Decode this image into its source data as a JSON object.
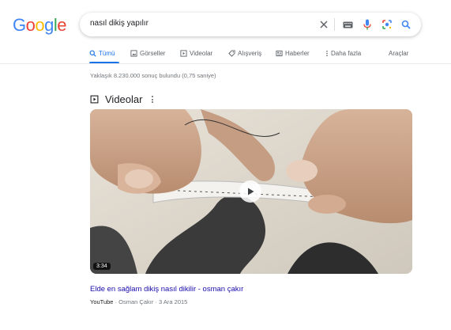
{
  "logo": {
    "letters": [
      "G",
      "o",
      "o",
      "g",
      "l",
      "e"
    ],
    "colors": [
      "#4285F4",
      "#EA4335",
      "#FBBC05",
      "#4285F4",
      "#34A853",
      "#EA4335"
    ]
  },
  "search": {
    "query": "nasıl dikiş yapılır",
    "icons": [
      "close-icon",
      "keyboard-icon",
      "mic-icon",
      "lens-icon",
      "search-icon"
    ]
  },
  "tabs": [
    {
      "label": "Tümü",
      "icon": "search-icon",
      "active": true
    },
    {
      "label": "Görseller",
      "icon": "image-icon",
      "active": false
    },
    {
      "label": "Videolar",
      "icon": "video-icon",
      "active": false
    },
    {
      "label": "Alışveriş",
      "icon": "tag-icon",
      "active": false
    },
    {
      "label": "Haberler",
      "icon": "news-icon",
      "active": false
    },
    {
      "label": "Daha fazla",
      "icon": "more-vert-icon",
      "active": false
    }
  ],
  "tools_label": "Araçlar",
  "result_stats": "Yaklaşık 8.230.000 sonuç bulundu (0,75 saniye)",
  "videos": {
    "heading": "Videolar",
    "items": [
      {
        "title": "Elde en sağlam dikiş nasıl dikilir - osman çakır",
        "source": "YouTube",
        "channel": "Osman Çakır",
        "date": "3 Ara 2015",
        "duration": "3:34"
      }
    ]
  },
  "colors": {
    "accent": "#1a73e8",
    "link": "#1a0dab",
    "muted": "#70757a"
  }
}
